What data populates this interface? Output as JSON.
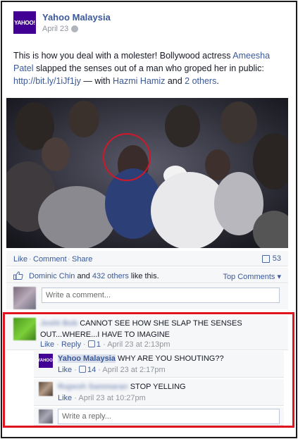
{
  "post": {
    "page_name": "Yahoo Malaysia",
    "page_logo_text": "YAHOO!",
    "date": "April 23",
    "text_before": "This is how you deal with a molester! Bollywood actress ",
    "mention_1": "Ameesha Patel",
    "text_middle": " slapped the senses out of a man who groped her in public: ",
    "link": "http://bit.ly/1iJf1jy",
    "text_with": " — with ",
    "mention_2": "Hazmi Hamiz",
    "text_and": " and ",
    "mention_3": "2 others",
    "text_end": "."
  },
  "actions": {
    "like": "Like",
    "comment": "Comment",
    "share": "Share",
    "dot": "·",
    "share_count": "53"
  },
  "likes": {
    "first_name": "Dominic Chin",
    "and_text": " and ",
    "others": "432 others",
    "suffix": " like this.",
    "top_comments": "Top Comments ▾"
  },
  "compose": {
    "placeholder": "Write a comment..."
  },
  "comment1": {
    "author": "Joshi Bob",
    "text": "CANNOT SEE HOW SHE SLAP THE SENSES OUT...WHERE...I HAVE TO IMAGINE",
    "like": "Like",
    "reply": "Reply",
    "like_count": "1",
    "time": "April 23 at 2:13pm"
  },
  "reply1": {
    "author": "Yahoo Malaysia",
    "logo_text": "YAHOO!",
    "text": "WHY ARE YOU SHOUTING??",
    "like": "Like",
    "like_count": "14",
    "time": "April 23 at 2:17pm"
  },
  "reply2": {
    "author": "Rupesh Sammaran",
    "text": "STOP YELLING",
    "like": "Like",
    "time": "April 23 at 10:27pm"
  },
  "reply_compose": {
    "placeholder": "Write a reply..."
  },
  "colors": {
    "facebook_blue": "#3b5998",
    "highlight_red": "#e0141e",
    "yahoo_purple": "#410093"
  }
}
